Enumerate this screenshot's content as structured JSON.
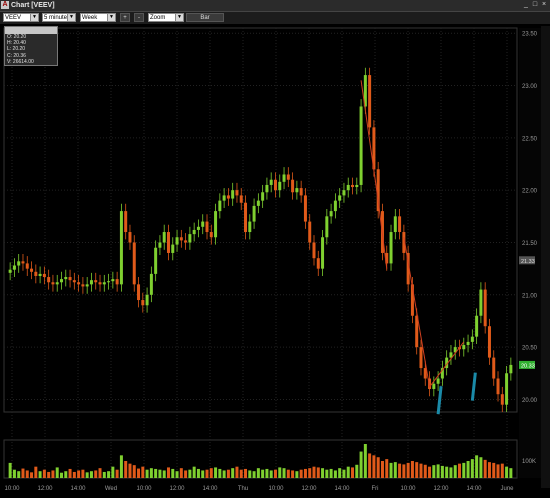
{
  "window": {
    "title": "Chart [VEEV]"
  },
  "toolbar": {
    "symbol": "VEEV",
    "interval": "5 minutes",
    "range": "Week",
    "plus_label": "+",
    "minus_label": "-",
    "zoom": "Zoom",
    "bar_label": "Bar"
  },
  "info": {
    "header": "",
    "open": "O: 20.20",
    "high": "H: 20.40",
    "low": "L: 20.20",
    "close": "C: 20.36",
    "volume": "V: 26614.00"
  },
  "markers": {
    "last_price": "21.33",
    "current_price": "20.33",
    "time_marker": ""
  },
  "colors": {
    "up": "#7fd030",
    "down": "#e05a1a",
    "trendline": "#d04020",
    "arrow": "#1a8aa8",
    "grid": "#222222"
  },
  "chart_data": {
    "type": "bar",
    "subtype": "ohlc-candles-with-volume",
    "y_ticks": [
      "23.50",
      "23.00",
      "22.50",
      "22.00",
      "21.50",
      "21.00",
      "20.50",
      "20.00"
    ],
    "ylim": [
      19.88,
      23.55
    ],
    "volume_tick": "100K",
    "x_ticks": [
      "10:00",
      "12:00",
      "14:00",
      "Wed",
      "10:00",
      "12:00",
      "14:00",
      "Thu",
      "10:00",
      "12:00",
      "14:00",
      "Fri",
      "10:00",
      "12:00",
      "14:00",
      "June"
    ],
    "closes": [
      21.24,
      21.28,
      21.32,
      21.3,
      21.25,
      21.22,
      21.18,
      21.2,
      21.17,
      21.12,
      21.1,
      21.12,
      21.15,
      21.17,
      21.14,
      21.12,
      21.1,
      21.08,
      21.1,
      21.14,
      21.12,
      21.1,
      21.12,
      21.13,
      21.15,
      21.1,
      21.8,
      21.6,
      21.5,
      21.1,
      20.95,
      20.9,
      21.0,
      21.2,
      21.45,
      21.5,
      21.6,
      21.4,
      21.48,
      21.55,
      21.52,
      21.5,
      21.58,
      21.62,
      21.65,
      21.7,
      21.6,
      21.55,
      21.8,
      21.9,
      21.95,
      21.92,
      22.0,
      21.95,
      21.88,
      21.6,
      21.7,
      21.85,
      21.9,
      21.98,
      22.05,
      22.1,
      22.0,
      22.08,
      22.15,
      22.1,
      21.98,
      22.02,
      21.95,
      21.7,
      21.5,
      21.35,
      21.25,
      21.55,
      21.75,
      21.8,
      21.9,
      21.95,
      22.0,
      22.05,
      22.03,
      22.05,
      22.8,
      23.1,
      22.6,
      22.2,
      21.8,
      21.4,
      21.3,
      21.6,
      21.75,
      21.6,
      21.4,
      21.1,
      20.8,
      20.5,
      20.3,
      20.2,
      20.1,
      20.15,
      20.2,
      20.3,
      20.4,
      20.45,
      20.5,
      20.48,
      20.52,
      20.55,
      20.6,
      20.8,
      21.05,
      20.7,
      20.4,
      20.2,
      20.05,
      19.95,
      20.25,
      20.33
    ],
    "volumes": [
      40,
      22,
      18,
      25,
      20,
      15,
      30,
      18,
      22,
      16,
      20,
      28,
      14,
      18,
      24,
      16,
      20,
      22,
      15,
      18,
      20,
      26,
      16,
      18,
      30,
      22,
      60,
      45,
      38,
      34,
      25,
      30,
      22,
      26,
      24,
      22,
      20,
      28,
      24,
      18,
      26,
      20,
      22,
      30,
      24,
      20,
      22,
      26,
      28,
      24,
      20,
      22,
      26,
      30,
      22,
      24,
      20,
      18,
      26,
      22,
      24,
      20,
      22,
      28,
      26,
      22,
      20,
      18,
      22,
      24,
      26,
      30,
      28,
      26,
      22,
      24,
      20,
      26,
      22,
      30,
      28,
      35,
      70,
      90,
      65,
      60,
      55,
      45,
      50,
      40,
      42,
      38,
      36,
      40,
      45,
      42,
      38,
      35,
      30,
      34,
      36,
      32,
      30,
      28,
      34,
      38,
      40,
      45,
      50,
      60,
      55,
      48,
      42,
      40,
      36,
      38,
      30,
      26
    ]
  }
}
